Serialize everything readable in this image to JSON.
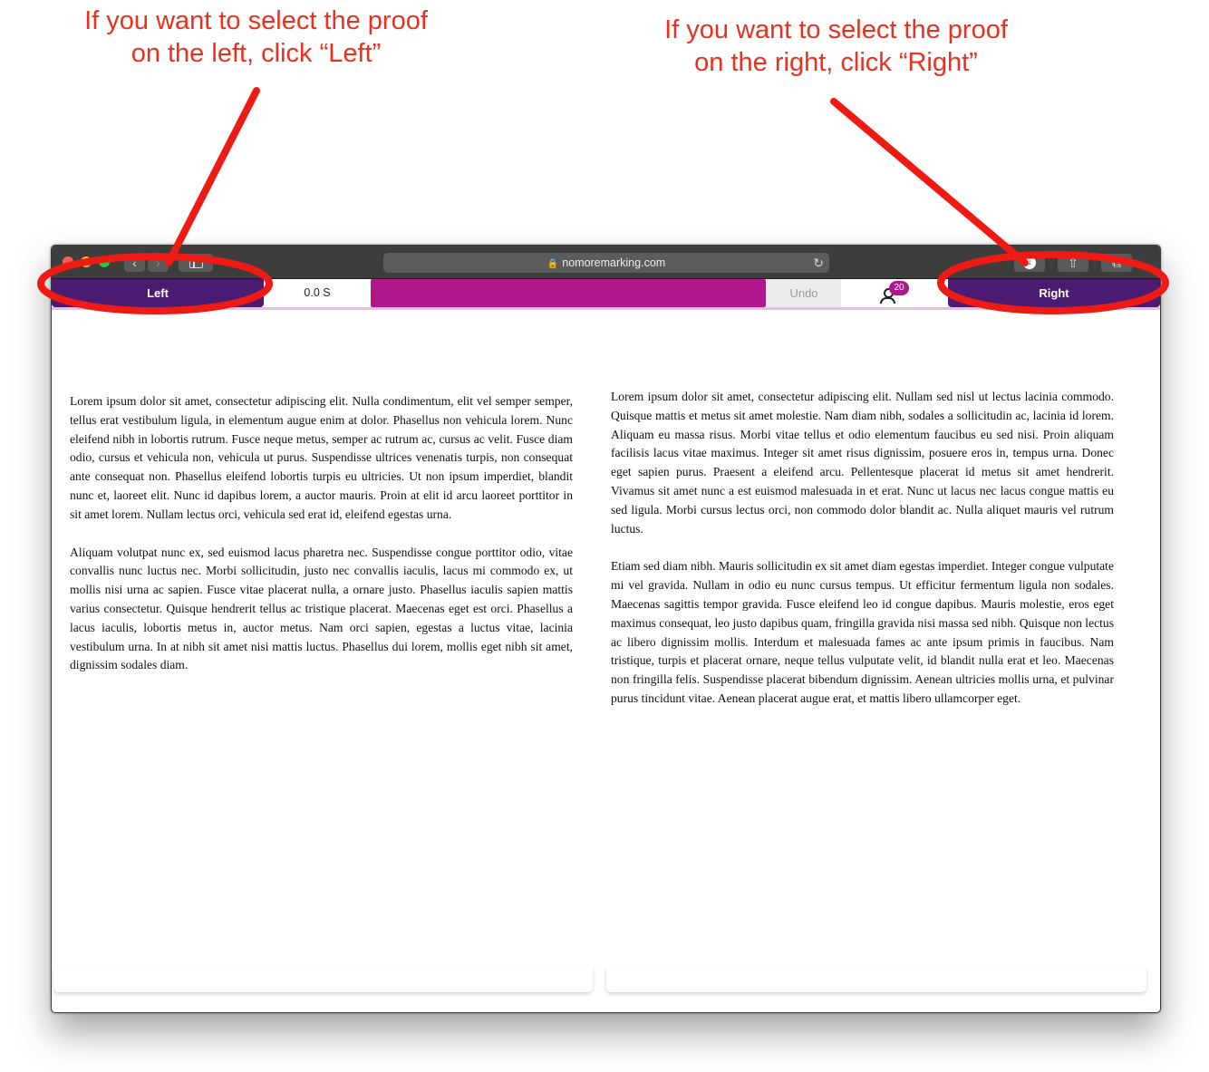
{
  "annotations": {
    "left_line1": "If you want to select the proof",
    "left_line2": "on the left, click “Left”",
    "right_line1": "If you want to select the proof",
    "right_line2": "on the right, click “Right”",
    "color": "#e8321f"
  },
  "browser": {
    "url": "nomoremarking.com",
    "back_icon": "chevron-left-icon",
    "forward_icon": "chevron-right-icon",
    "lock_icon": "lock-icon",
    "reload_icon": "reload-icon"
  },
  "toolbar": {
    "left_label": "Left",
    "timer": "0.0 S",
    "undo_label": "Undo",
    "badge_count": "20",
    "right_label": "Right",
    "accent": "#4a1b70",
    "progress_color": "#b0178a"
  },
  "proofs": {
    "left": [
      "Lorem ipsum dolor sit amet, consectetur adipiscing elit. Nulla condimentum, elit vel semper semper, tellus erat vestibulum ligula, in elementum augue enim at dolor. Phasellus non vehicula lorem. Nunc eleifend nibh in lobortis rutrum. Fusce neque metus, semper ac rutrum ac, cursus ac velit. Fusce diam odio, cursus et vehicula non, vehicula ut purus. Suspendisse ultrices venenatis turpis, non consequat ante consequat non. Phasellus eleifend lobortis turpis eu ultricies. Ut non ipsum imperdiet, blandit nunc et, laoreet elit. Nunc id dapibus lorem, a auctor mauris. Proin at elit id arcu laoreet porttitor in sit amet lorem. Nullam lectus orci, vehicula sed erat id, eleifend egestas urna.",
      "Aliquam volutpat nunc ex, sed euismod lacus pharetra nec. Suspendisse congue porttitor odio, vitae convallis nunc luctus nec. Morbi sollicitudin, justo nec convallis iaculis, lacus mi commodo ex, ut mollis nisi urna ac sapien. Fusce vitae placerat nulla, a ornare justo. Phasellus iaculis sapien mattis varius consectetur. Quisque hendrerit tellus ac tristique placerat. Maecenas eget est orci. Phasellus a lacus iaculis, lobortis metus in, auctor metus. Nam orci sapien, egestas a luctus vitae, lacinia vestibulum urna. In at nibh sit amet nisi mattis luctus. Phasellus dui lorem, mollis eget nibh sit amet, dignissim sodales diam."
    ],
    "right": [
      "Lorem ipsum dolor sit amet, consectetur adipiscing elit. Nullam sed nisl ut lectus lacinia commodo. Quisque mattis et metus sit amet molestie. Nam diam nibh, sodales a sollicitudin ac, lacinia id lorem. Aliquam eu massa risus. Morbi vitae tellus et odio elementum faucibus eu sed nisi. Proin aliquam facilisis lacus vitae maximus. Integer sit amet risus dignissim, posuere eros in, tempus urna. Donec eget sapien purus. Praesent a eleifend arcu. Pellentesque placerat id metus sit amet hendrerit. Vivamus sit amet nunc a est euismod malesuada in et erat. Nunc ut lacus nec lacus congue mattis eu sed ligula. Morbi cursus lectus orci, non commodo dolor blandit ac. Nulla aliquet mauris vel rutrum luctus.",
      "Etiam sed diam nibh. Mauris sollicitudin ex sit amet diam egestas imperdiet. Integer congue vulputate mi vel gravida. Nullam in odio eu nunc cursus tempus. Ut efficitur fermentum ligula non sodales. Maecenas sagittis tempor gravida. Fusce eleifend leo id congue dapibus. Mauris molestie, eros eget maximus consequat, leo justo dapibus quam, fringilla gravida nisi massa sed nibh. Quisque non lectus ac libero dignissim mollis. Interdum et malesuada fames ac ante ipsum primis in faucibus. Nam tristique, turpis et placerat ornare, neque tellus vulputate velit, id blandit nulla erat et leo. Maecenas non fringilla felis. Suspendisse placerat bibendum dignissim. Aenean ultricies mollis urna, et pulvinar purus tincidunt vitae. Aenean placerat augue erat, et mattis libero ullamcorper eget."
    ]
  }
}
